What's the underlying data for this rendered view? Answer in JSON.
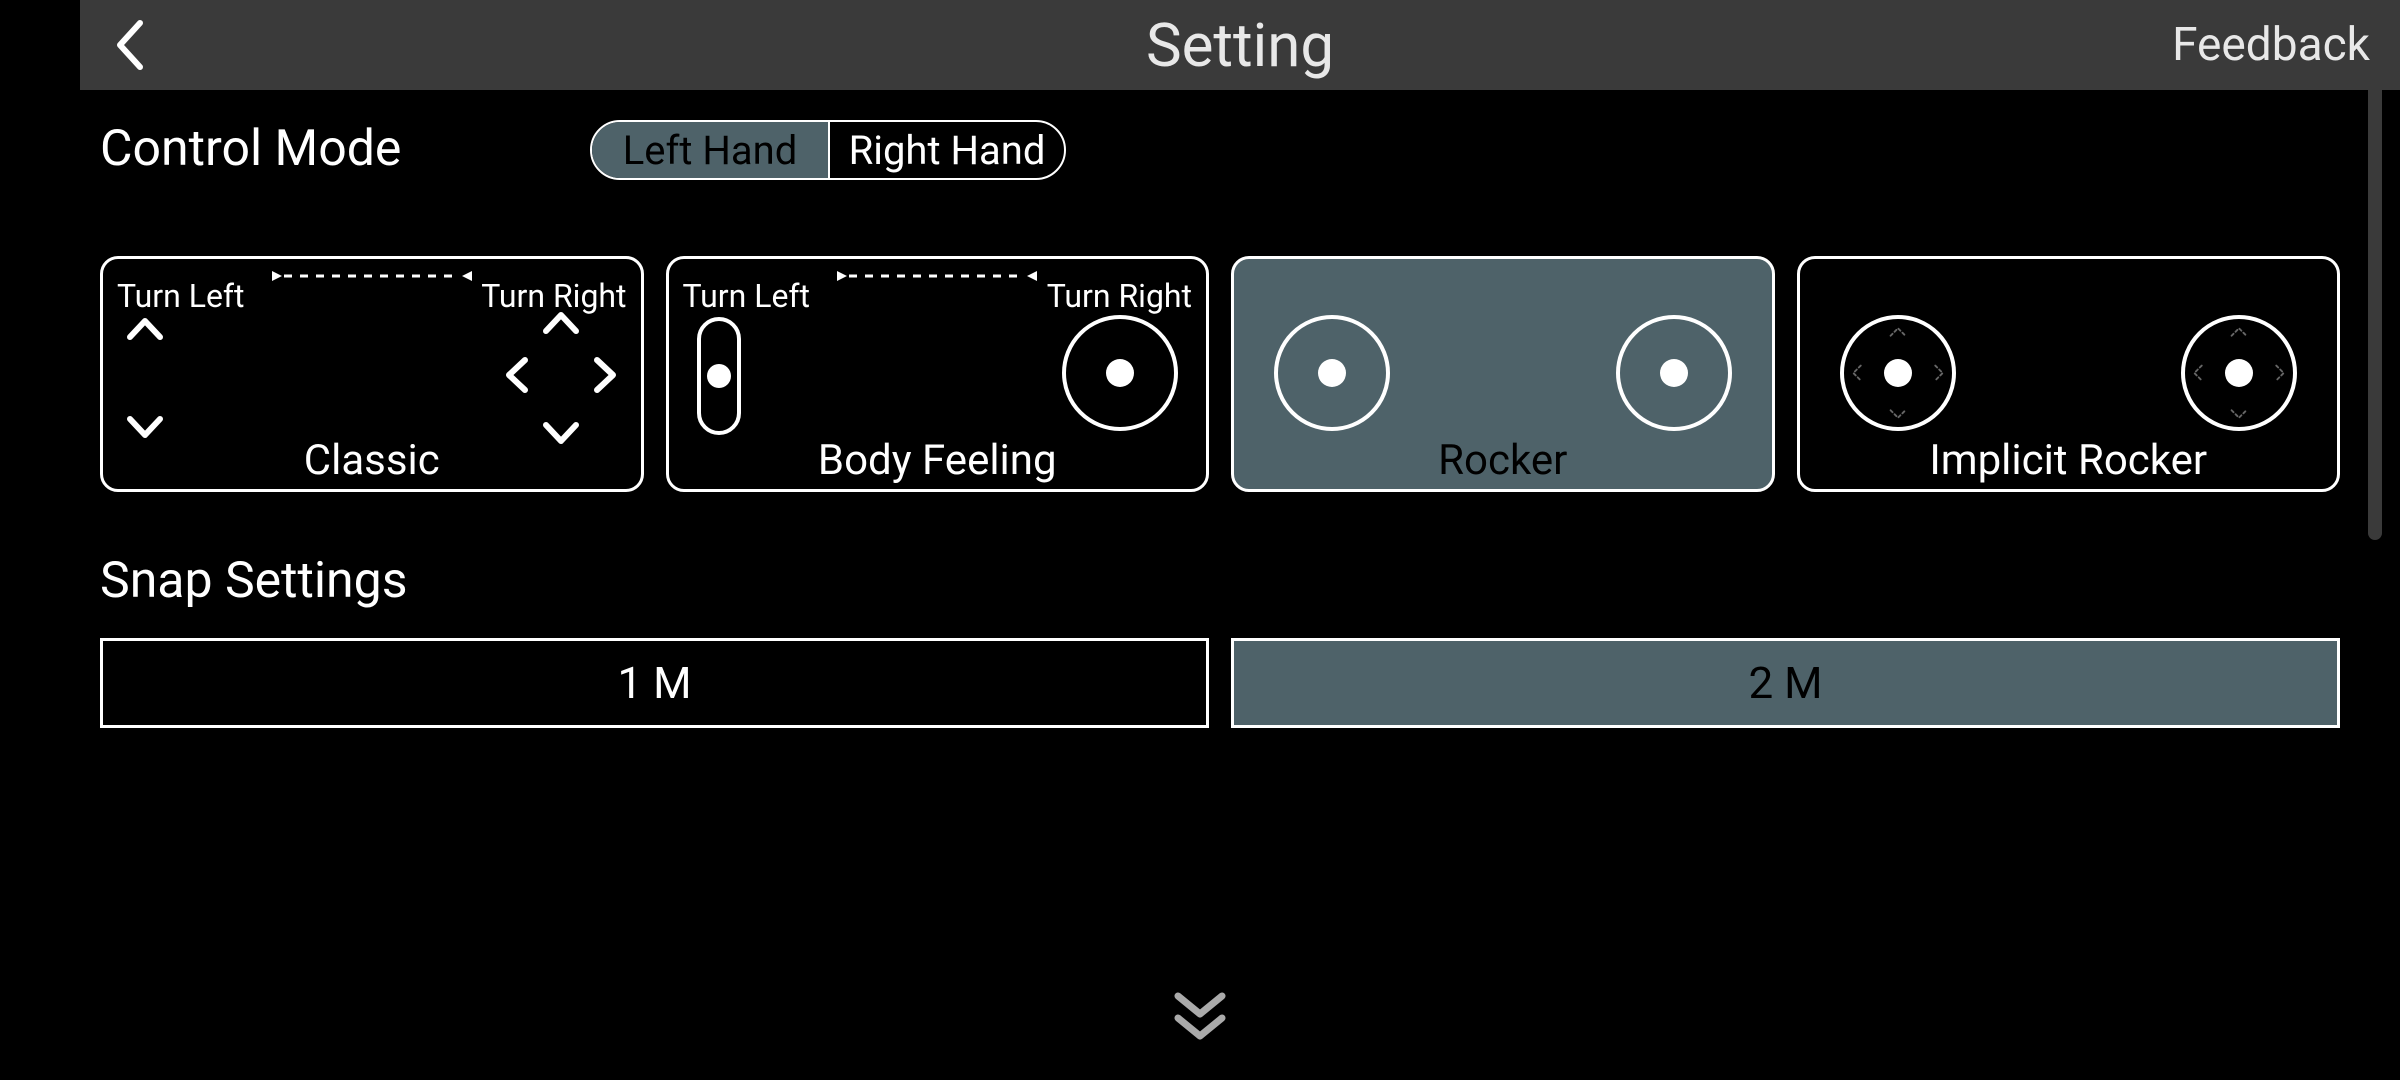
{
  "header": {
    "title": "Setting",
    "feedback_label": "Feedback"
  },
  "control_mode": {
    "section_label": "Control Mode",
    "hand_options": [
      {
        "label": "Left Hand",
        "selected": true
      },
      {
        "label": "Right Hand",
        "selected": false
      }
    ],
    "modes": [
      {
        "label": "Classic",
        "turn_left": "Turn Left",
        "turn_right": "Turn Right",
        "selected": false
      },
      {
        "label": "Body Feeling",
        "turn_left": "Turn Left",
        "turn_right": "Turn Right",
        "selected": false
      },
      {
        "label": "Rocker",
        "selected": true
      },
      {
        "label": "Implicit Rocker",
        "selected": false
      }
    ]
  },
  "snap_settings": {
    "section_label": "Snap Settings",
    "options": [
      {
        "label": "1 M",
        "selected": false
      },
      {
        "label": "2 M",
        "selected": true
      }
    ]
  },
  "colors": {
    "topbar_bg": "#3a3a3a",
    "selected_bg": "#4e6269",
    "page_bg": "#000000"
  }
}
